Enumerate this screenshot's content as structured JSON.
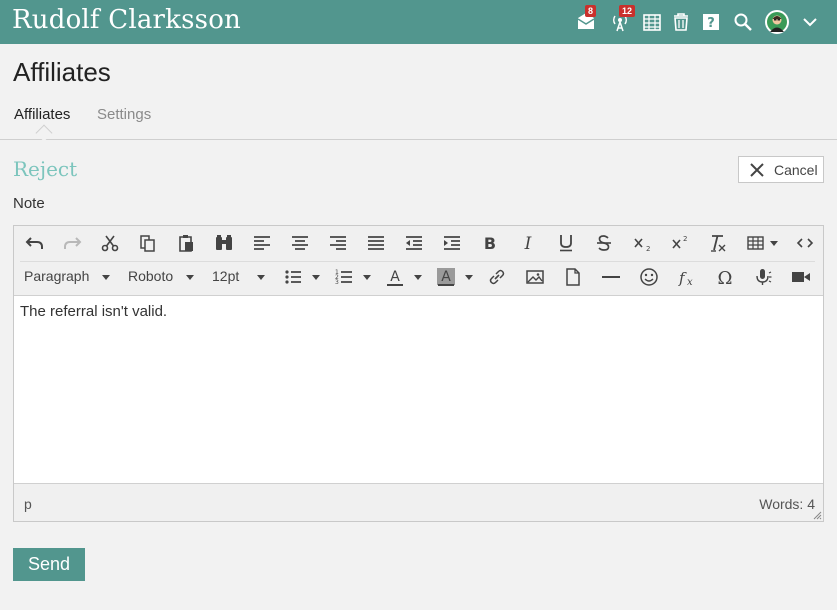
{
  "header": {
    "title": "Rudolf Clarksson",
    "icons": {
      "messages": {
        "name": "envelope-icon",
        "badge": "8"
      },
      "notifications": {
        "name": "broadcast-icon",
        "badge": "12"
      },
      "calendar": {
        "name": "calendar-icon"
      },
      "trash": {
        "name": "trash-icon"
      },
      "help": {
        "name": "help-icon"
      },
      "search": {
        "name": "search-icon"
      }
    },
    "colors": {
      "bar": "#52968e",
      "badge": "#c9302c"
    }
  },
  "page": {
    "title": "Affiliates",
    "tabs": [
      {
        "label": "Affiliates",
        "active": true
      },
      {
        "label": "Settings",
        "active": false
      }
    ]
  },
  "section": {
    "title": "Reject",
    "cancel_label": "Cancel",
    "note_label": "Note",
    "title_color": "#7cc5bd"
  },
  "editor": {
    "format_select": "Paragraph",
    "font_select": "Roboto",
    "size_select": "12pt",
    "content": "The referral isn't valid.",
    "path": "p",
    "word_count": "Words: 4"
  },
  "actions": {
    "send_label": "Send"
  }
}
